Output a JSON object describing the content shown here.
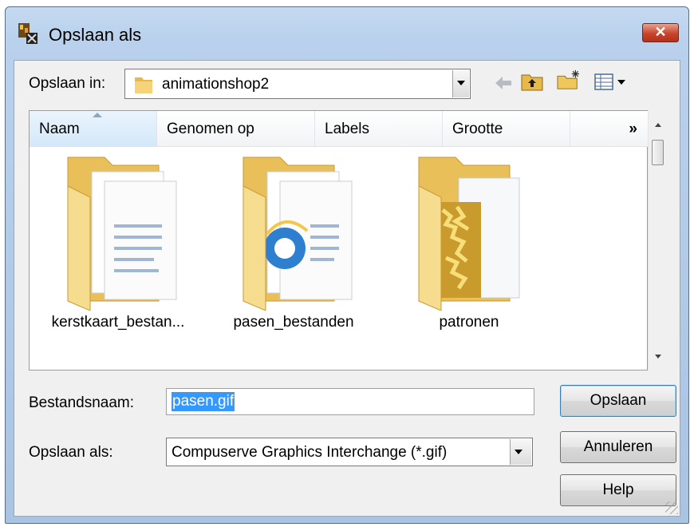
{
  "window": {
    "title": "Opslaan als",
    "close_glyph": "✕"
  },
  "location": {
    "label": "Opslaan in:",
    "value": "animationshop2"
  },
  "toolbar": {
    "icons": [
      "back-arrow-icon",
      "up-folder-icon",
      "new-folder-icon",
      "view-menu-icon"
    ]
  },
  "columns": [
    "Naam",
    "Genomen op",
    "Labels",
    "Grootte"
  ],
  "columns_more": "»",
  "items": [
    {
      "name": "kerstkaart_bestan..."
    },
    {
      "name": "pasen_bestanden"
    },
    {
      "name": "patronen"
    }
  ],
  "filename": {
    "label": "Bestandsnaam:",
    "value": "pasen.gif"
  },
  "filetype": {
    "label": "Opslaan als:",
    "value": "Compuserve Graphics Interchange (*.gif)"
  },
  "buttons": {
    "save": "Opslaan",
    "cancel": "Annuleren",
    "help": "Help"
  },
  "colors": {
    "folder": "#f4d27c",
    "selection": "#3399ff",
    "close": "#c9442c"
  }
}
